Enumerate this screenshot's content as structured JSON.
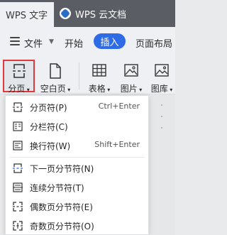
{
  "tabs": {
    "active": "WPS 文字",
    "other": "WPS 云文档"
  },
  "ribbon": {
    "file_label": "文件",
    "tabs": [
      "开始",
      "插入",
      "页面布局"
    ],
    "active_tab_index": 1,
    "accent_color": "#2e6be6"
  },
  "toolbar": {
    "buttons": [
      {
        "label": "分页",
        "icon": "page-break-icon",
        "has_dropdown": true,
        "selected": true
      },
      {
        "label": "空白页",
        "icon": "blank-page-icon",
        "has_dropdown": true
      },
      {
        "label": "表格",
        "icon": "table-icon",
        "has_dropdown": true
      },
      {
        "label": "图片",
        "icon": "picture-icon",
        "has_dropdown": true
      },
      {
        "label": "图库",
        "icon": "gallery-icon",
        "has_dropdown": true
      }
    ],
    "highlight_color": "#e4393c"
  },
  "menu": {
    "items": [
      {
        "label": "分页符(P)",
        "shortcut": "Ctrl+Enter",
        "icon": "page-break-icon"
      },
      {
        "label": "分栏符(C)",
        "shortcut": "",
        "icon": "column-break-icon"
      },
      {
        "label": "换行符(W)",
        "shortcut": "Shift+Enter",
        "icon": "line-break-icon"
      },
      {
        "label": "下一页分节符(N)",
        "shortcut": "",
        "icon": "next-page-section-break-icon"
      },
      {
        "label": "连续分节符(T)",
        "shortcut": "",
        "icon": "continuous-section-break-icon"
      },
      {
        "label": "偶数页分节符(E)",
        "shortcut": "",
        "icon": "even-page-section-break-icon"
      },
      {
        "label": "奇数页分节符(O)",
        "shortcut": "",
        "icon": "odd-page-section-break-icon"
      }
    ]
  }
}
